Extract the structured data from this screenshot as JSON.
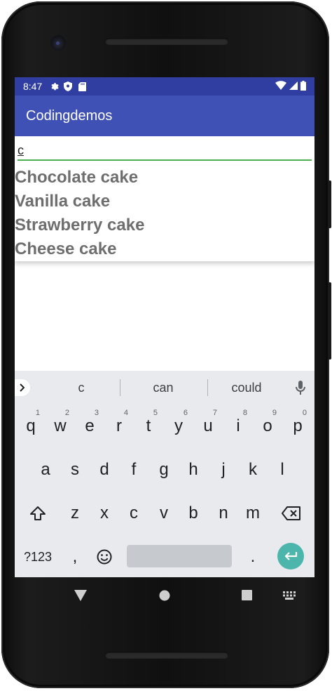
{
  "status_bar": {
    "time": "8:47",
    "left_icons": [
      "gear-icon",
      "shield-icon",
      "sd-card-icon"
    ],
    "right_icons": [
      "wifi-icon",
      "signal-icon",
      "battery-icon"
    ]
  },
  "app_bar": {
    "title": "Codingdemos"
  },
  "search": {
    "value": "c"
  },
  "suggestions": [
    "Chocolate cake",
    "Vanilla cake",
    "Strawberry cake",
    "Cheese cake"
  ],
  "keyboard": {
    "predictions": [
      "c",
      "can",
      "could"
    ],
    "row1": [
      {
        "key": "q",
        "hint": "1"
      },
      {
        "key": "w",
        "hint": "2"
      },
      {
        "key": "e",
        "hint": "3"
      },
      {
        "key": "r",
        "hint": "4"
      },
      {
        "key": "t",
        "hint": "5"
      },
      {
        "key": "y",
        "hint": "6"
      },
      {
        "key": "u",
        "hint": "7"
      },
      {
        "key": "i",
        "hint": "8"
      },
      {
        "key": "o",
        "hint": "9"
      },
      {
        "key": "p",
        "hint": "0"
      }
    ],
    "row2": [
      "a",
      "s",
      "d",
      "f",
      "g",
      "h",
      "j",
      "k",
      "l"
    ],
    "row3": [
      "z",
      "x",
      "c",
      "v",
      "b",
      "n",
      "m"
    ],
    "symbols_label": "?123",
    "comma": ",",
    "period": "."
  },
  "colors": {
    "status_bar": "#2f3ea0",
    "app_bar": "#3f51b5",
    "input_underline": "#4caf50",
    "suggestion_text": "#6e6e6e",
    "enter_key": "#4db6ac"
  }
}
